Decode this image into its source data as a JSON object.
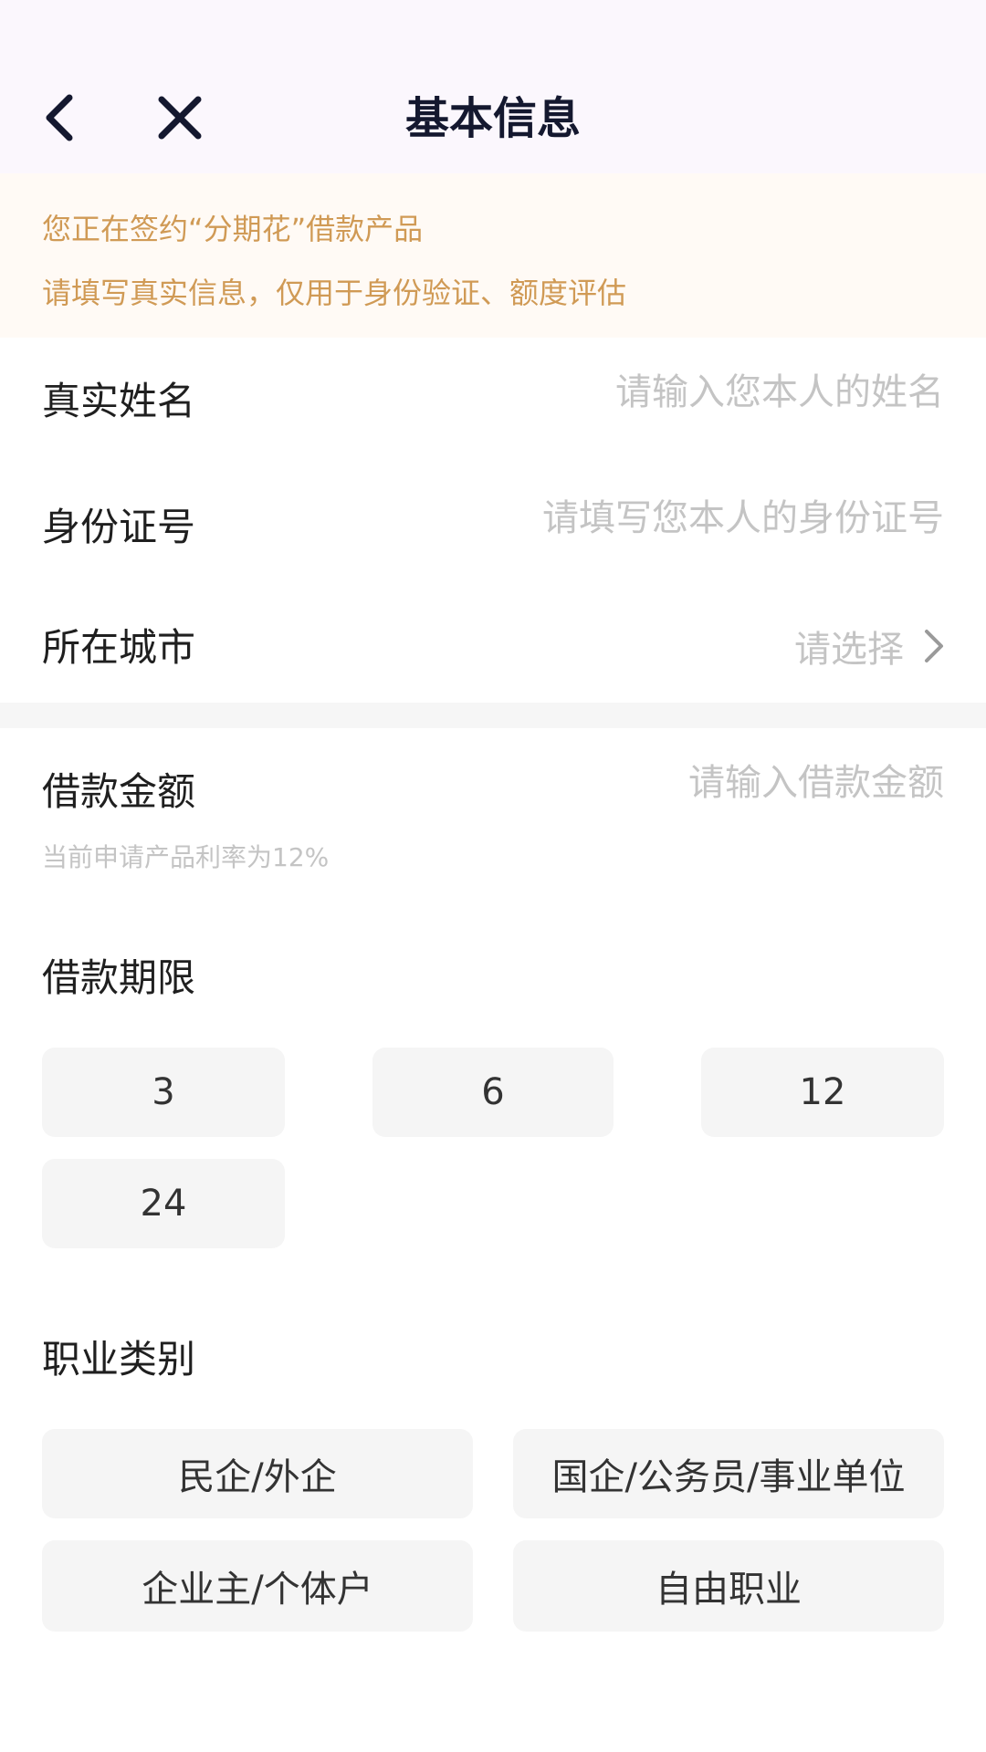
{
  "header": {
    "title": "基本信息",
    "back_icon": "chevron-left-icon",
    "close_icon": "close-icon"
  },
  "notice": {
    "line1": "您正在签约“分期花”借款产品",
    "line2": "请填写真实信息，仅用于身份验证、额度评估"
  },
  "form": {
    "name": {
      "label": "真实姓名",
      "placeholder": "请输入您本人的姓名",
      "value": ""
    },
    "id_number": {
      "label": "身份证号",
      "placeholder": "请填写您本人的身份证号",
      "value": ""
    },
    "city": {
      "label": "所在城市",
      "placeholder": "请选择"
    },
    "amount": {
      "label": "借款金额",
      "placeholder": "请输入借款金额",
      "value": "",
      "rate_note": "当前申请产品利率为12%"
    },
    "term": {
      "label": "借款期限",
      "options": [
        "3",
        "6",
        "12",
        "24"
      ]
    },
    "occupation": {
      "label": "职业类别",
      "options": [
        "民企/外企",
        "国企/公务员/事业单位",
        "企业主/个体户",
        "自由职业"
      ]
    }
  },
  "colors": {
    "header_bg": "#fbf7fd",
    "notice_bg": "#fffaf5",
    "notice_text": "#d09a55",
    "title_text": "#14182f",
    "placeholder": "#c4c4c4",
    "chip_bg": "#f5f5f5"
  }
}
